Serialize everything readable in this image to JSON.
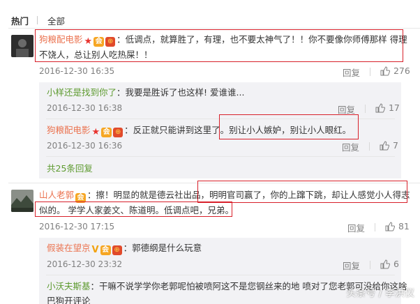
{
  "tabs": {
    "hot": "热门",
    "all": "全部"
  },
  "comments": [
    {
      "username": "狗粮配电影",
      "lines": [
        "：低调点，就算胜了，有理，也不要太神气了！！你不要像你师傅那样 得理",
        "不饶人，总让别人吃热屎！！"
      ],
      "time": "2016-12-30 16:35",
      "reply_label": "回复",
      "likes": "276"
    },
    {
      "username": "山人老郭",
      "lines": [
        "：擦！明显的就是德云社出品，明明官司赢了，你的上蹿下跳，却让人感觉小人得志",
        "似的。 学学人家姜文、陈道明。低调点吧，兄弟。"
      ],
      "time": "2016-12-30 17:15",
      "reply_label": "回复",
      "likes": "81"
    }
  ],
  "replies_1": [
    {
      "username": "小样还是找到你了",
      "text": "：我要是胜诉了也这样! 爱谁谁...",
      "time": "2016-12-30 16:38",
      "reply_label": "回复",
      "likes": "17"
    },
    {
      "username": "狗粮配电影",
      "text": "：反正就只能讲到这里了。别让小人嫉妒，别让小人眼红。",
      "time": "2016-12-30 16:36",
      "reply_label": "回复",
      "likes": "7"
    }
  ],
  "more_replies": "共25条回复",
  "replies_2": [
    {
      "username": "假装在望京",
      "text": "：郭德纲是什么玩意",
      "time": "2016-12-30 23:32",
      "reply_label": "回复",
      "likes": "6"
    },
    {
      "username": "小沃夫斯基",
      "lines": [
        "：干嘛不说学学你老郭呢怕被喷阿这不是您钢丝来的地 喷对了您老郭可没给你这啥",
        "巴狗开评论"
      ]
    }
  ],
  "watermark": "头条号 / 李洪仪",
  "colors": {
    "username": "#eb7350",
    "green_link": "#5d9a2f",
    "highlight_box": "#d8202a",
    "reply_bg": "#f2f2f5"
  }
}
